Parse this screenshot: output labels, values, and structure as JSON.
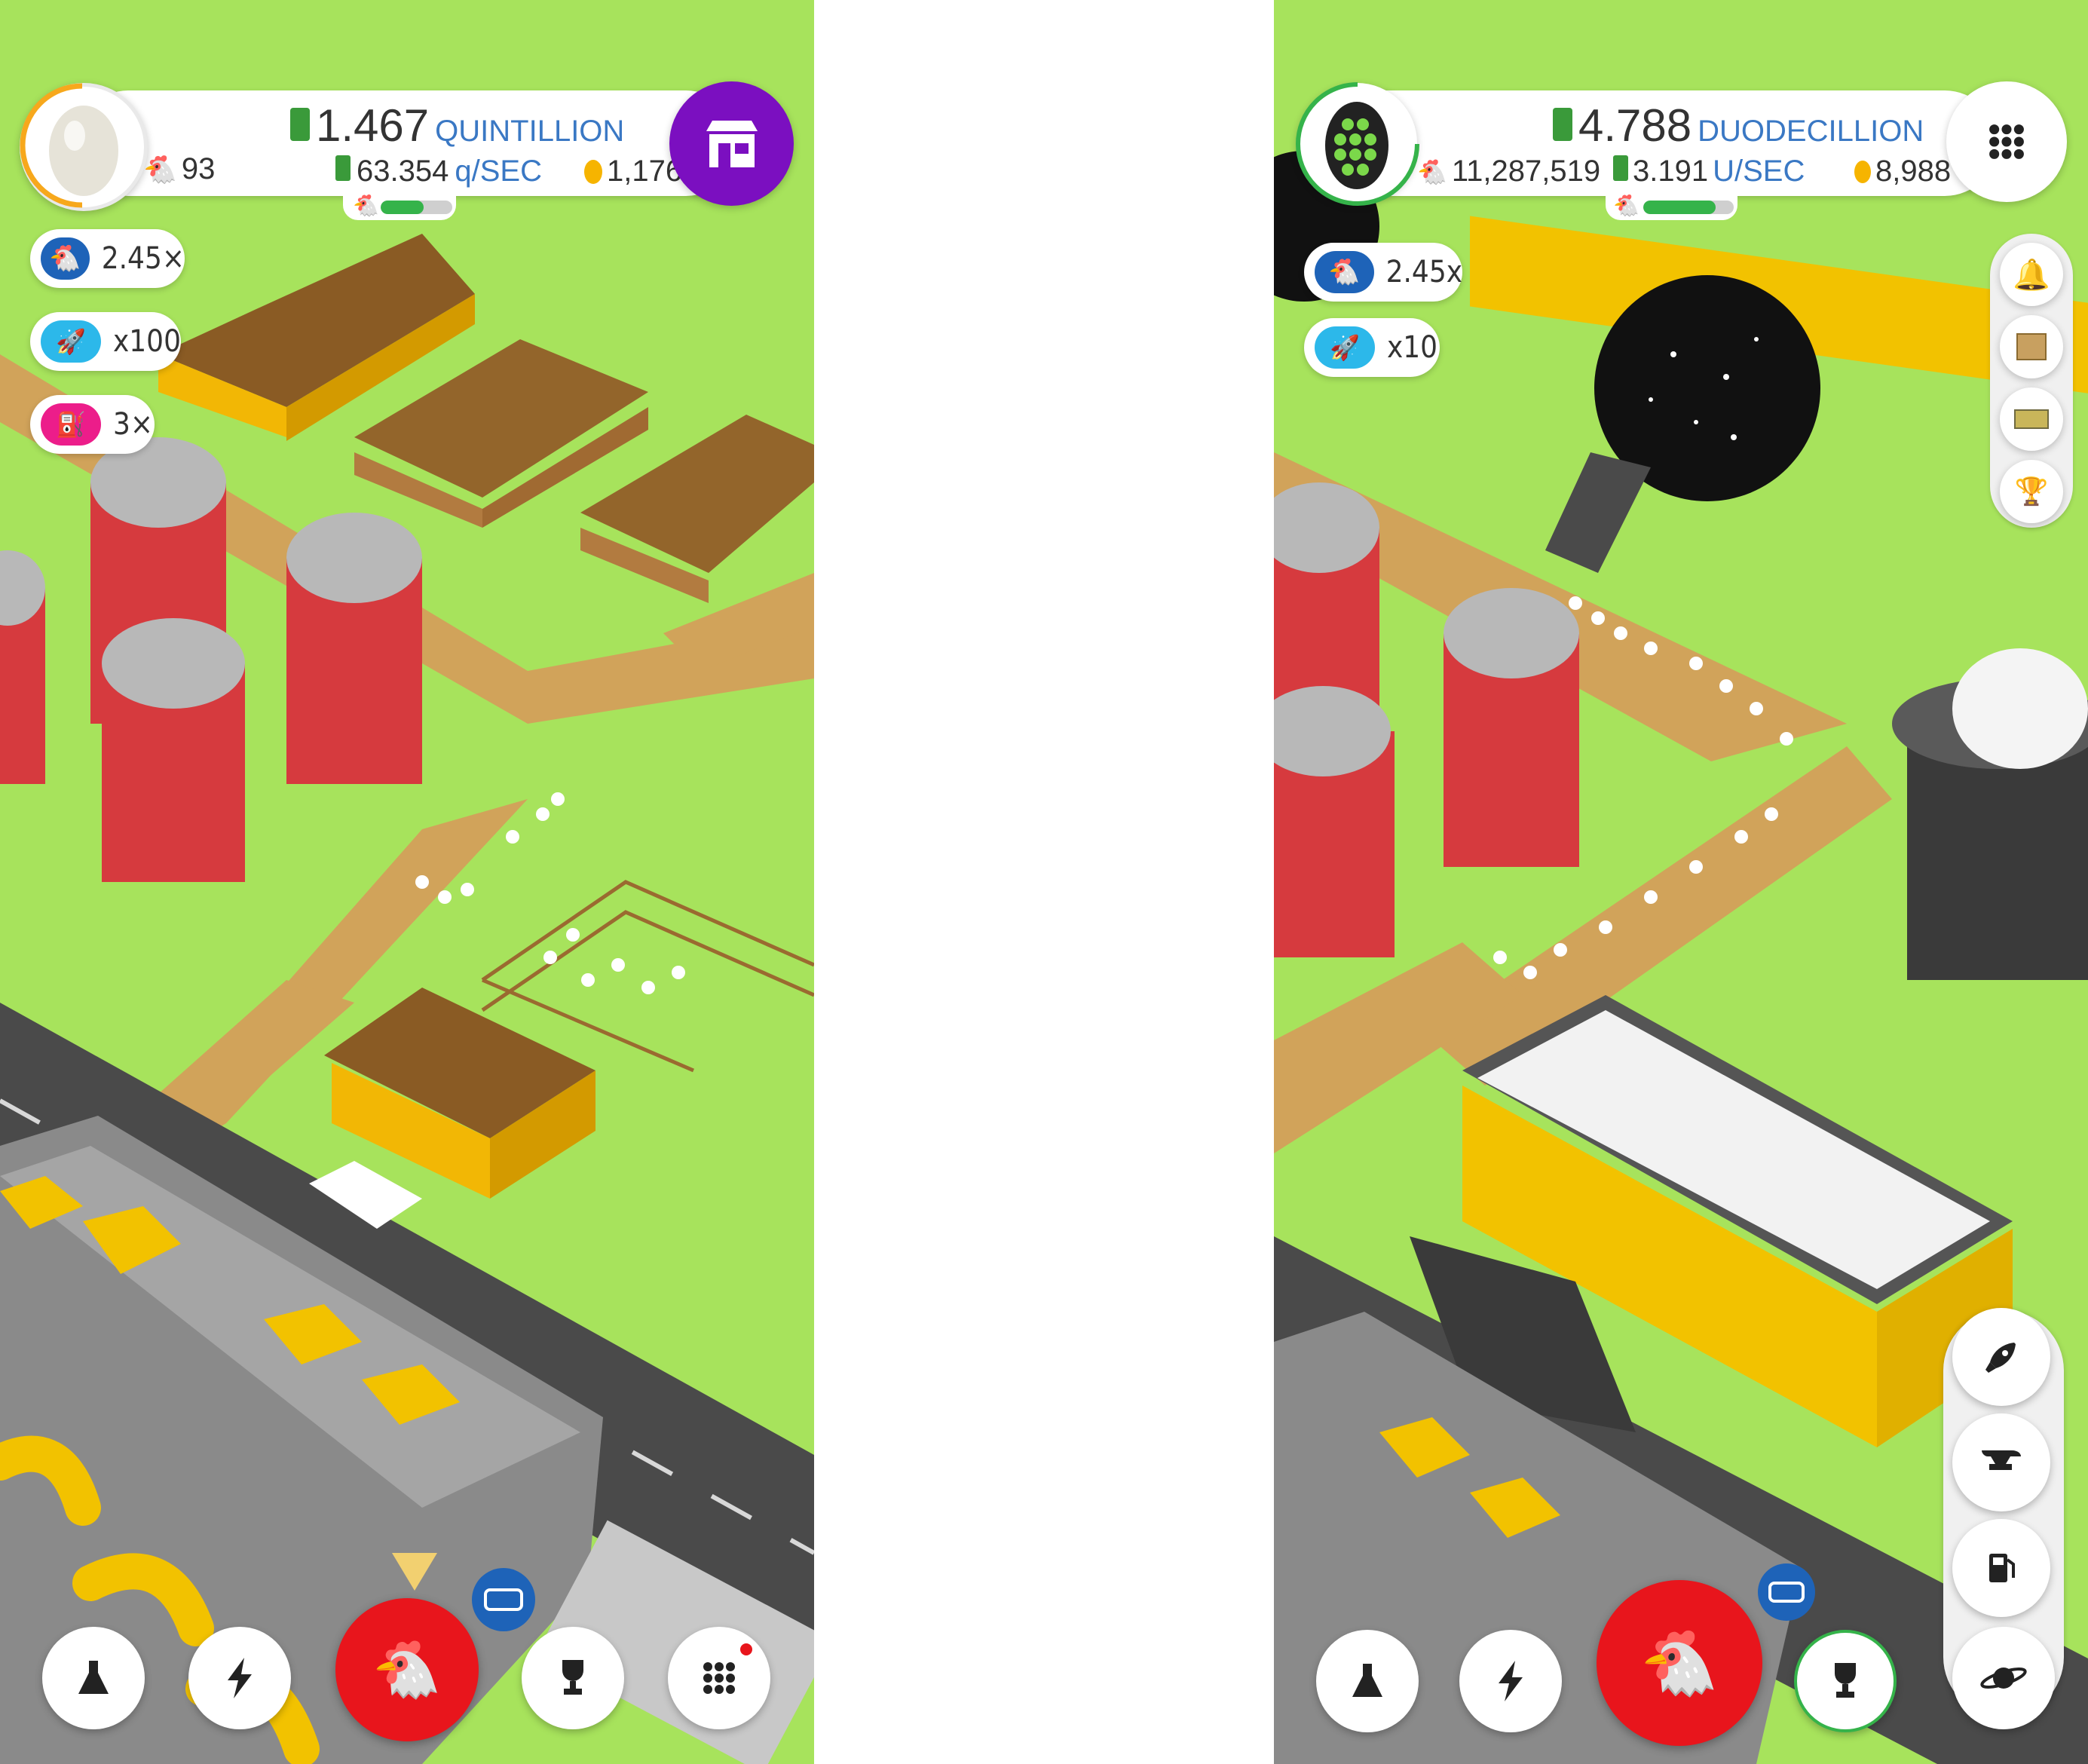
{
  "colors": {
    "grass": "#a7e35c",
    "dirt": "#d1a35a",
    "road": "#4a4a4a",
    "silo_red": "#d63a3e",
    "shop_purple": "#7b0fc0",
    "chicken_red": "#e8151c",
    "unit_blue": "#3a78c4",
    "pill_blue": "#1e63b8",
    "pill_cyan": "#2cb8ea",
    "pill_pink": "#ec1d8a"
  },
  "screens": [
    {
      "egg": {
        "type": "regular-egg"
      },
      "cash": {
        "value": "1.467",
        "unit": "QUINTILLION"
      },
      "chickens": "93",
      "rate": {
        "value": "63.354",
        "unit": "q/SEC"
      },
      "golden_eggs": "1,176",
      "habitat_progress": 0.6,
      "top_right_button": {
        "icon": "shop-icon"
      },
      "boosts": [
        {
          "icon": "chicken-icon",
          "label": "2.45×",
          "color": "#1e63b8"
        },
        {
          "icon": "rocket-icon",
          "label": "x100",
          "color": "#2cb8ea"
        },
        {
          "icon": "fuel-icon",
          "label": "3×",
          "color": "#ec1d8a"
        }
      ],
      "nav": [
        {
          "icon": "flask-icon"
        },
        {
          "icon": "lightning-icon"
        },
        {
          "icon": "chicken-icon"
        },
        {
          "icon": "trophy-icon"
        },
        {
          "icon": "grid-icon"
        }
      ]
    },
    {
      "egg": {
        "type": "honeycomb-egg"
      },
      "cash": {
        "value": "4.788",
        "unit": "DUODECILLION"
      },
      "chickens": "11,287,519",
      "rate": {
        "value": "3.191",
        "unit": "U/SEC"
      },
      "golden_eggs": "8,988",
      "habitat_progress": 0.8,
      "top_right_button": {
        "icon": "grid-icon"
      },
      "boosts": [
        {
          "icon": "chicken-icon",
          "label": "2.45x",
          "color": "#1e63b8"
        },
        {
          "icon": "rocket-icon",
          "label": "x10",
          "color": "#2cb8ea"
        }
      ],
      "side_icons": [
        "bell-icon",
        "box-icon",
        "crate-icon",
        "trophy-icon"
      ],
      "right_menu": [
        "rocket-icon",
        "anvil-icon",
        "fuel-pump-icon",
        "planet-icon"
      ],
      "nav": [
        {
          "icon": "flask-icon"
        },
        {
          "icon": "lightning-icon"
        },
        {
          "icon": "chicken-icon"
        },
        {
          "icon": "trophy-icon"
        }
      ]
    }
  ]
}
